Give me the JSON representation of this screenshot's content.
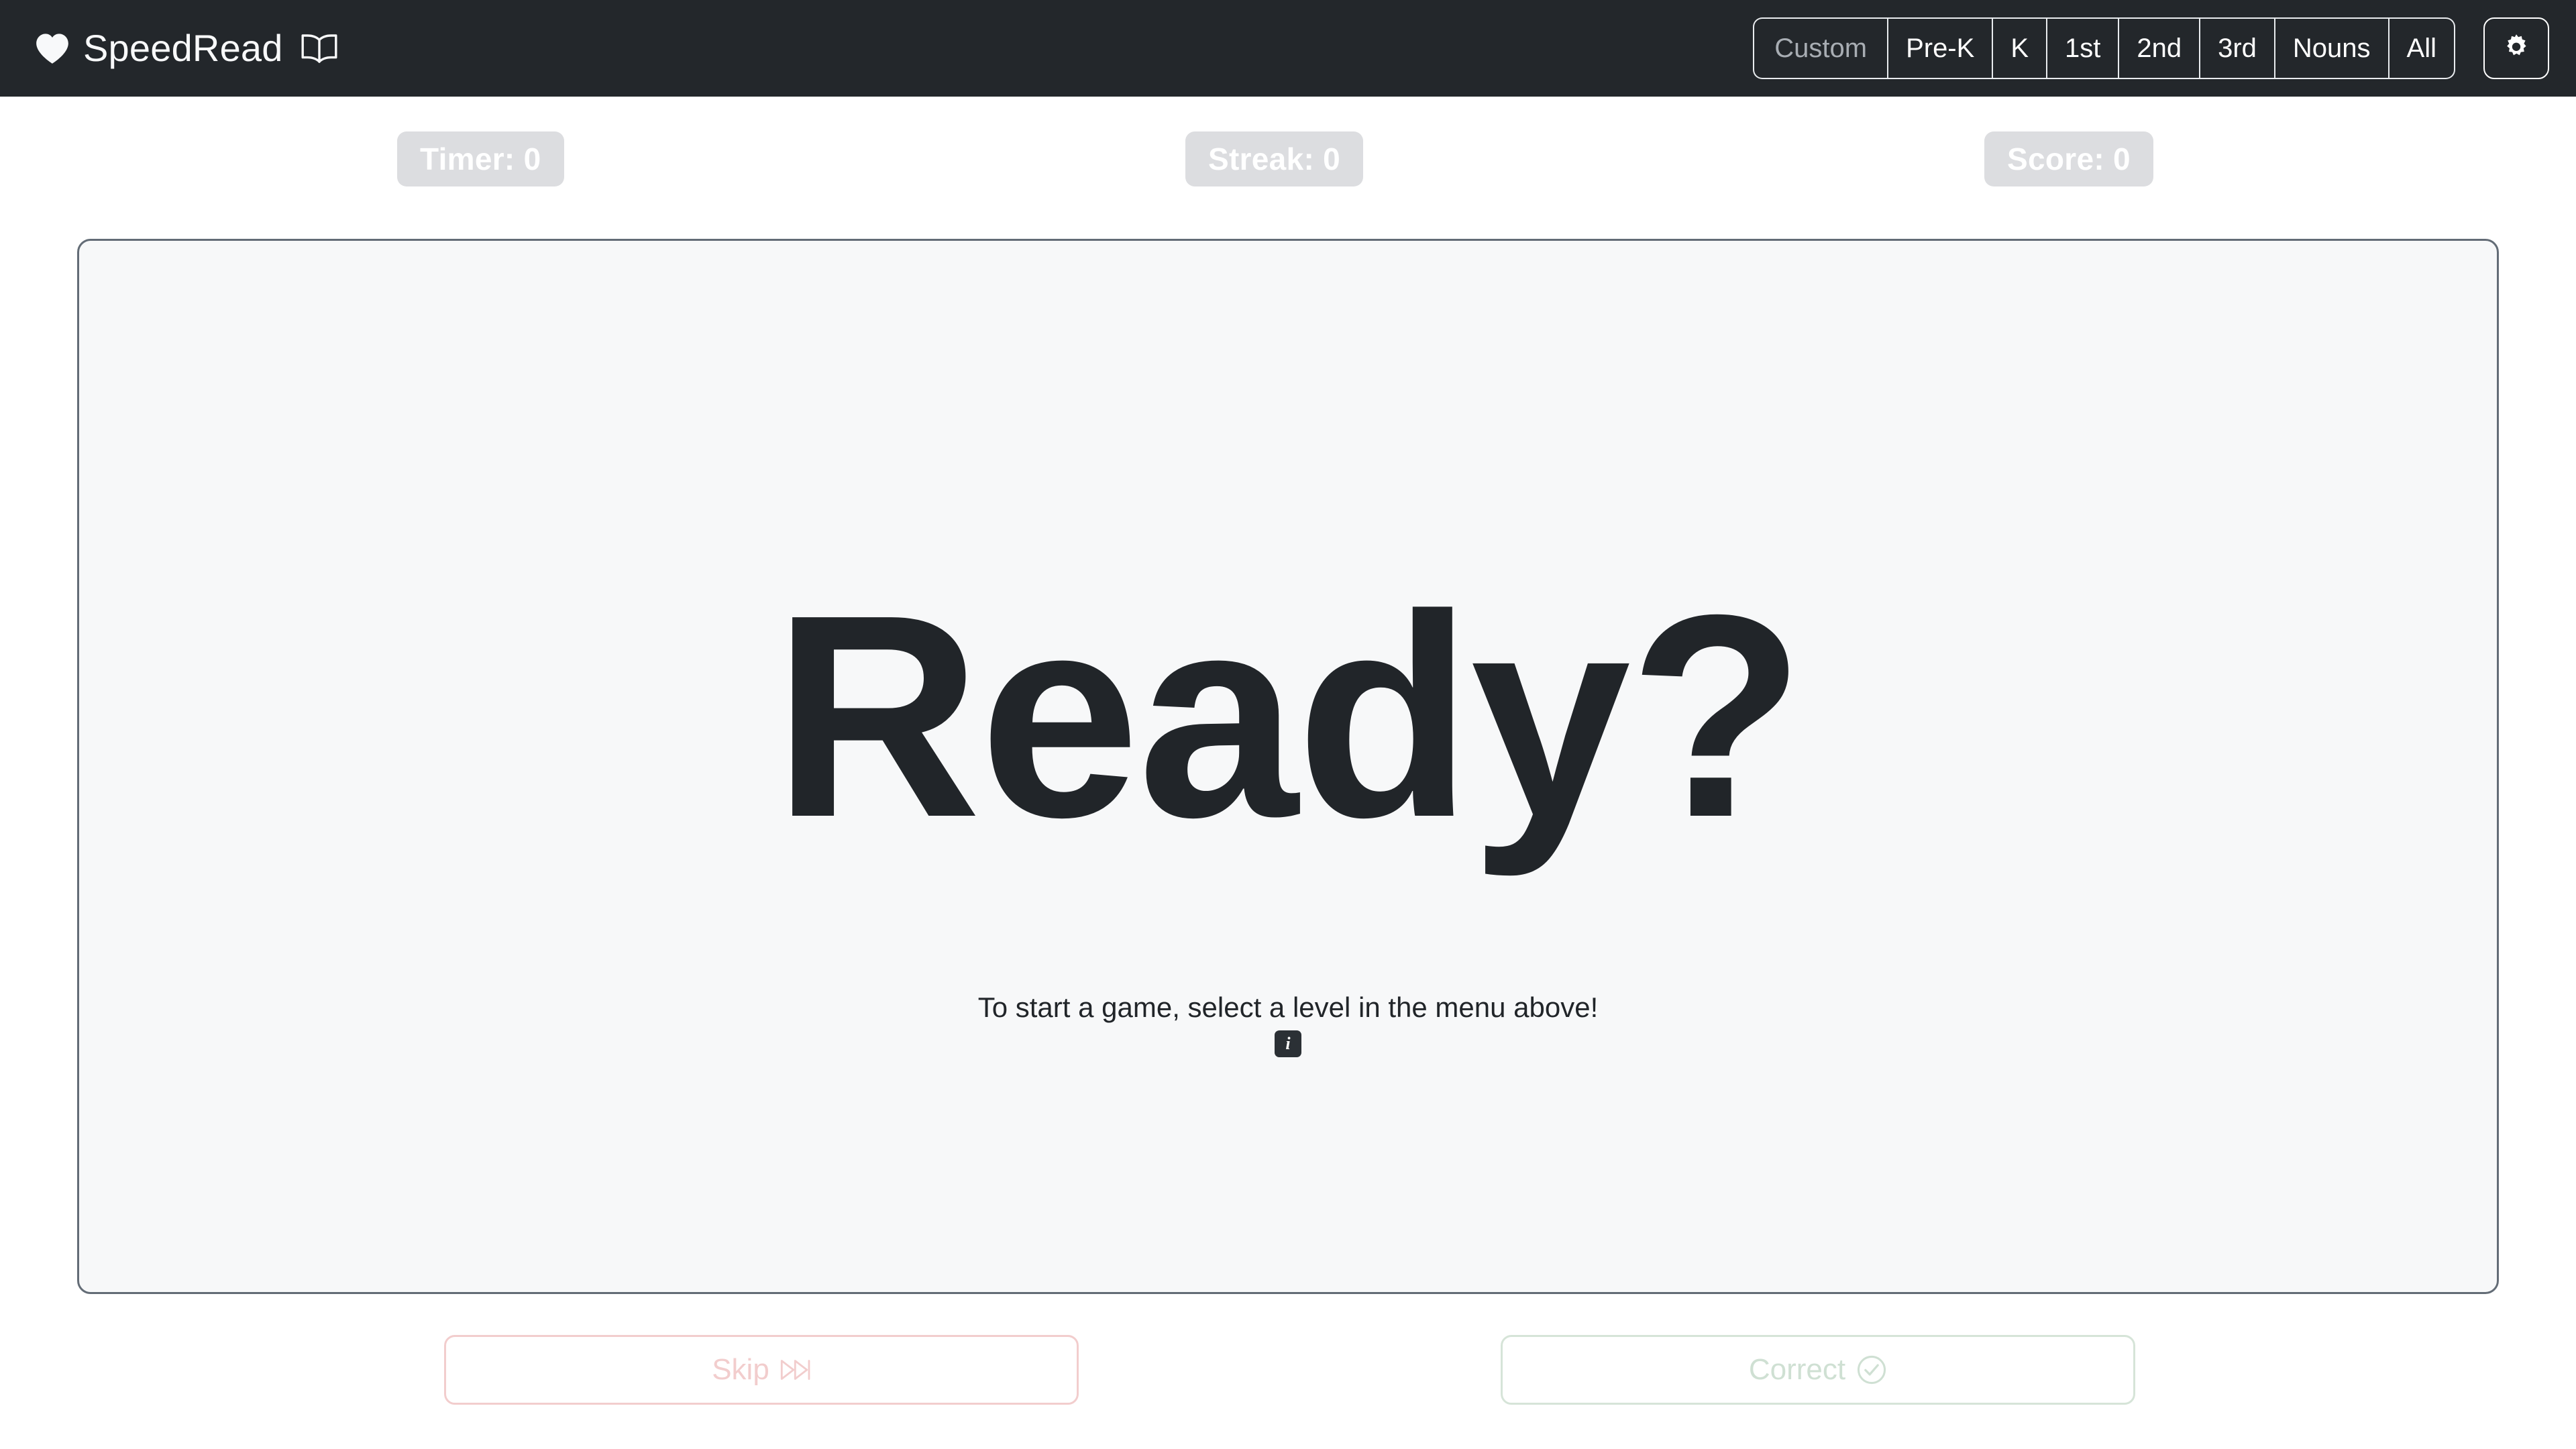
{
  "navbar": {
    "brand": {
      "heart_icon": "heart-icon",
      "name": "SpeedRead",
      "book_icon": "book-open-icon"
    },
    "levels": [
      {
        "label": "Custom",
        "state": "disabled"
      },
      {
        "label": "Pre-K",
        "state": "enabled"
      },
      {
        "label": "K",
        "state": "enabled"
      },
      {
        "label": "1st",
        "state": "enabled"
      },
      {
        "label": "2nd",
        "state": "enabled"
      },
      {
        "label": "3rd",
        "state": "enabled"
      },
      {
        "label": "Nouns",
        "state": "enabled"
      },
      {
        "label": "All",
        "state": "enabled"
      }
    ],
    "settings": {
      "icon": "gear-icon",
      "label": "Settings"
    }
  },
  "stats": {
    "timer": "Timer: 0",
    "streak": "Streak: 0",
    "score": "Score: 0"
  },
  "main": {
    "word": "Ready?",
    "hint": "To start a game, select a level in the menu above!",
    "info_badge": "i"
  },
  "actions": {
    "skip": {
      "label": "Skip",
      "icon": "fast-forward-icon",
      "state": "disabled"
    },
    "correct": {
      "label": "Correct",
      "icon": "check-circle-icon",
      "state": "disabled"
    }
  },
  "colors": {
    "navbar_bg": "#23272b",
    "page_bg": "#ffffff",
    "card_bg": "#f7f8f9",
    "card_border": "#636c76",
    "word_text": "#212529",
    "badge_bg": "#dcdde0",
    "skip_accent": "#f2cdcd",
    "correct_accent": "#d6e4d8"
  }
}
